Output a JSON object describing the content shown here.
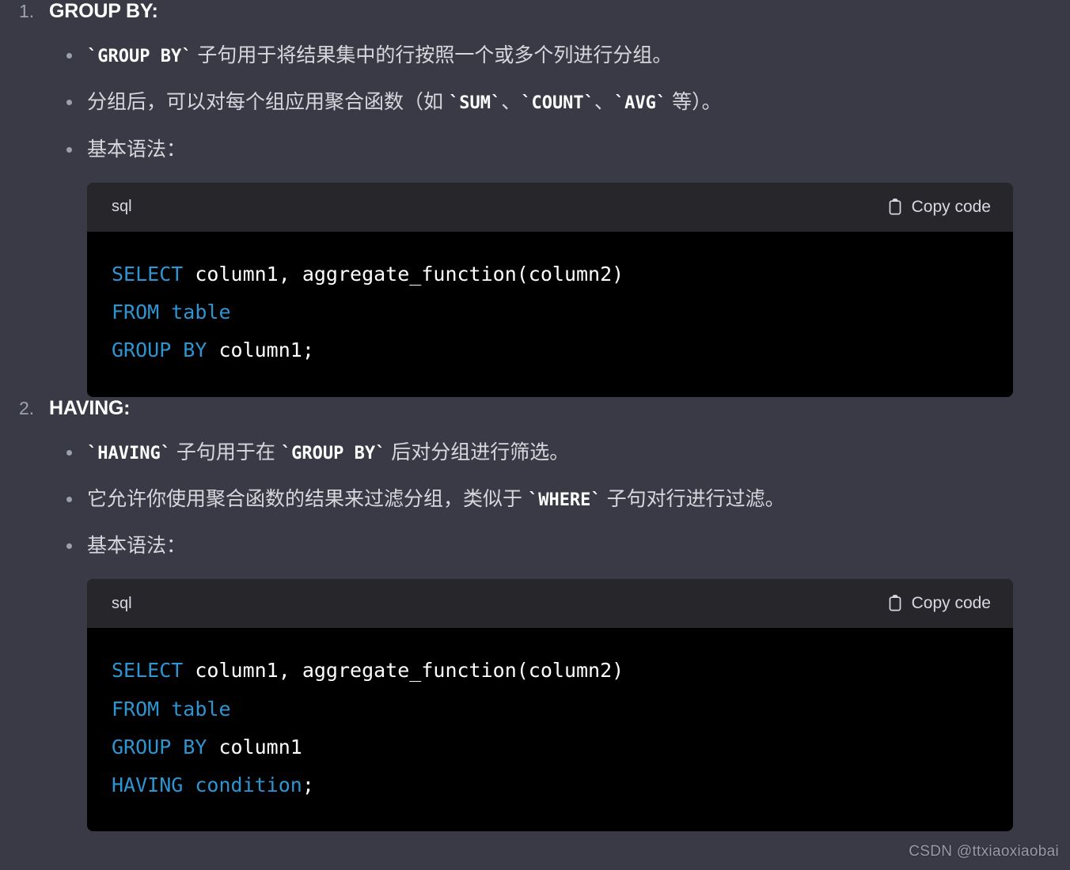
{
  "document": {
    "background_color": "#3a3a47",
    "code_header_color": "#26262b",
    "code_body_color": "#000000",
    "keyword_color": "#2e95d3",
    "watermark": "CSDN @ttxiaoxiaobai"
  },
  "sections": [
    {
      "number": "1.",
      "title": "GROUP BY:",
      "bullets": [
        {
          "parts": [
            {
              "type": "code",
              "text": "`GROUP BY`"
            },
            {
              "type": "text",
              "text": " 子句用于将结果集中的行按照一个或多个列进行分组。"
            }
          ]
        },
        {
          "parts": [
            {
              "type": "text",
              "text": "分组后，可以对每个组应用聚合函数（如 "
            },
            {
              "type": "code",
              "text": "`SUM`"
            },
            {
              "type": "text",
              "text": "、"
            },
            {
              "type": "code",
              "text": "`COUNT`"
            },
            {
              "type": "text",
              "text": "、"
            },
            {
              "type": "code",
              "text": "`AVG`"
            },
            {
              "type": "text",
              "text": " 等）。"
            }
          ]
        },
        {
          "parts": [
            {
              "type": "text",
              "text": "基本语法："
            }
          ]
        }
      ],
      "code": {
        "language": "sql",
        "copy_label": "Copy code",
        "copy_icon": "clipboard-icon",
        "lines": [
          [
            {
              "t": "kw",
              "v": "SELECT"
            },
            {
              "t": "pl",
              "v": " column1, aggregate_function(column2)"
            }
          ],
          [
            {
              "t": "kw",
              "v": "FROM table"
            }
          ],
          [
            {
              "t": "kw",
              "v": "GROUP BY"
            },
            {
              "t": "pl",
              "v": " column1;"
            }
          ]
        ]
      }
    },
    {
      "number": "2.",
      "title": "HAVING:",
      "bullets": [
        {
          "parts": [
            {
              "type": "code",
              "text": "`HAVING`"
            },
            {
              "type": "text",
              "text": " 子句用于在 "
            },
            {
              "type": "code",
              "text": "`GROUP BY`"
            },
            {
              "type": "text",
              "text": " 后对分组进行筛选。"
            }
          ]
        },
        {
          "parts": [
            {
              "type": "text",
              "text": "它允许你使用聚合函数的结果来过滤分组，类似于 "
            },
            {
              "type": "code",
              "text": "`WHERE`"
            },
            {
              "type": "text",
              "text": " 子句对行进行过滤。"
            }
          ]
        },
        {
          "parts": [
            {
              "type": "text",
              "text": "基本语法："
            }
          ]
        }
      ],
      "code": {
        "language": "sql",
        "copy_label": "Copy code",
        "copy_icon": "clipboard-icon",
        "lines": [
          [
            {
              "t": "kw",
              "v": "SELECT"
            },
            {
              "t": "pl",
              "v": " column1, aggregate_function(column2)"
            }
          ],
          [
            {
              "t": "kw",
              "v": "FROM table"
            }
          ],
          [
            {
              "t": "kw",
              "v": "GROUP BY"
            },
            {
              "t": "pl",
              "v": " column1"
            }
          ],
          [
            {
              "t": "kw",
              "v": "HAVING condition"
            },
            {
              "t": "pl",
              "v": ";"
            }
          ]
        ]
      }
    }
  ]
}
